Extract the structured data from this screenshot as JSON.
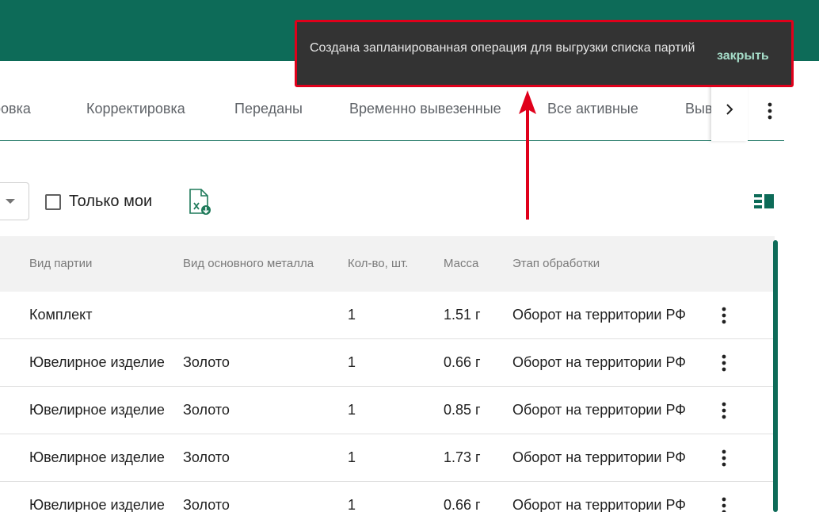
{
  "tabs": [
    {
      "label": "ровка"
    },
    {
      "label": "Корректировка"
    },
    {
      "label": "Переданы"
    },
    {
      "label": "Временно вывезенные"
    },
    {
      "label": "Все активные"
    },
    {
      "label": "Выв"
    }
  ],
  "filters": {
    "only_mine_label": "Только мои"
  },
  "table": {
    "headers": [
      "Вид партии",
      "Вид основного металла",
      "Кол-во, шт.",
      "Масса",
      "Этап обработки"
    ],
    "rows": [
      {
        "type": "Комплект",
        "metal": "",
        "qty": "1",
        "mass": "1.51 г",
        "stage": "Оборот на территории РФ"
      },
      {
        "type": "Ювелирное изделие",
        "metal": "Золото",
        "qty": "1",
        "mass": "0.66 г",
        "stage": "Оборот на территории РФ"
      },
      {
        "type": "Ювелирное изделие",
        "metal": "Золото",
        "qty": "1",
        "mass": "0.85 г",
        "stage": "Оборот на территории РФ"
      },
      {
        "type": "Ювелирное изделие",
        "metal": "Золото",
        "qty": "1",
        "mass": "1.73 г",
        "stage": "Оборот на территории РФ"
      },
      {
        "type": "Ювелирное изделие",
        "metal": "Золото",
        "qty": "1",
        "mass": "0.66 г",
        "stage": "Оборот на территории РФ"
      }
    ]
  },
  "snackbar": {
    "message": "Создана запланированная операция для выгрузки списка партий",
    "close_label": "закрыть"
  },
  "colors": {
    "brand": "#0d6b58",
    "highlight": "#e0001b"
  }
}
